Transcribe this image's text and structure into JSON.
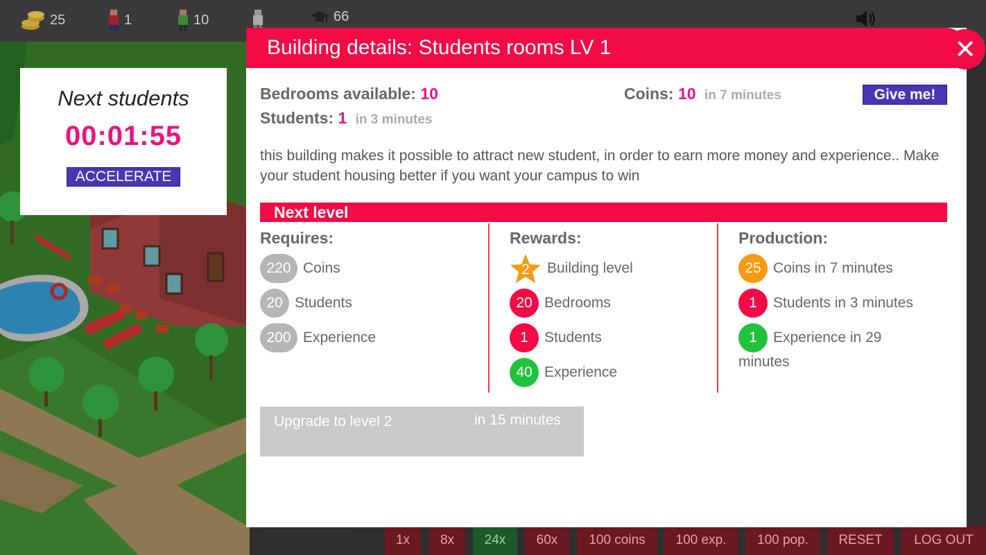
{
  "hud": {
    "coins": "25",
    "students_red": "1",
    "students_green": "10",
    "graduates": "66"
  },
  "next_students": {
    "title": "Next students",
    "timer": "00:01:55",
    "accelerate_label": "ACCELERATE"
  },
  "bottom_bar": {
    "items": [
      "1x",
      "8x",
      "24x",
      "60x",
      "100 coins",
      "100 exp.",
      "100 pop.",
      "RESET",
      "LOG OUT"
    ]
  },
  "modal": {
    "title": "Building details: Students rooms LV 1",
    "close_label": "✕",
    "bedrooms_label": "Bedrooms available:",
    "bedrooms_value": "10",
    "students_label": "Students:",
    "students_value": "1",
    "students_suffix": "in 3 minutes",
    "coins_label": "Coins:",
    "coins_value": "10",
    "coins_suffix": "in 7 minutes",
    "give_label": "Give me!",
    "description": "this building makes it possible to attract new student, in order to earn more money and experience.. Make your student housing better if you want your campus to win",
    "next_level_label": "Next level",
    "requires": {
      "title": "Requires:",
      "items": [
        {
          "value": "220",
          "label": "Coins"
        },
        {
          "value": "20",
          "label": "Students"
        },
        {
          "value": "200",
          "label": "Experience"
        }
      ]
    },
    "rewards": {
      "title": "Rewards:",
      "items": [
        {
          "value": "2",
          "label": "Building level"
        },
        {
          "value": "20",
          "label": "Bedrooms"
        },
        {
          "value": "1",
          "label": "Students"
        },
        {
          "value": "40",
          "label": "Experience"
        }
      ]
    },
    "production": {
      "title": "Production:",
      "items": [
        {
          "value": "25",
          "label": "Coins in 7 minutes"
        },
        {
          "value": "1",
          "label": "Students in 3 minutes"
        },
        {
          "value": "1",
          "label": "Experience in 29",
          "label2": "minutes"
        }
      ]
    },
    "upgrade": {
      "label": "Upgrade to level 2",
      "time": "in 15 minutes"
    }
  },
  "colors": {
    "accent_red": "#f20b45",
    "pink_value": "#ee1182",
    "button_purple": "#4a35b5",
    "badge_green": "#22c23a",
    "badge_orange": "#f59a12",
    "badge_grey": "#b5b5b5"
  }
}
